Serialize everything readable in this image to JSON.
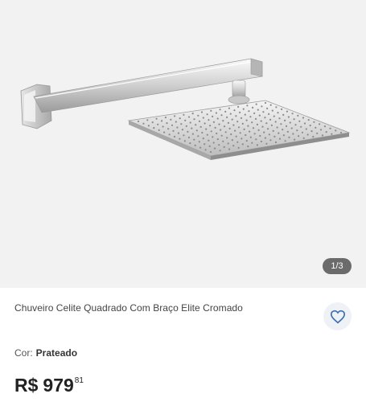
{
  "gallery": {
    "counter": "1/3"
  },
  "product": {
    "title": "Chuveiro Celite Quadrado Com Braço Elite Cromado",
    "favorite_icon": "heart-outline-icon",
    "color_label": "Cor:",
    "color_value": "Prateado",
    "price_currency": "R$",
    "price_integer": "979",
    "price_cents": "81"
  },
  "colors": {
    "image_bg": "#f2f2f2",
    "counter_bg": "#6b6b6b",
    "heart": "#3c6fb0",
    "fav_bg": "#eef2f7"
  }
}
